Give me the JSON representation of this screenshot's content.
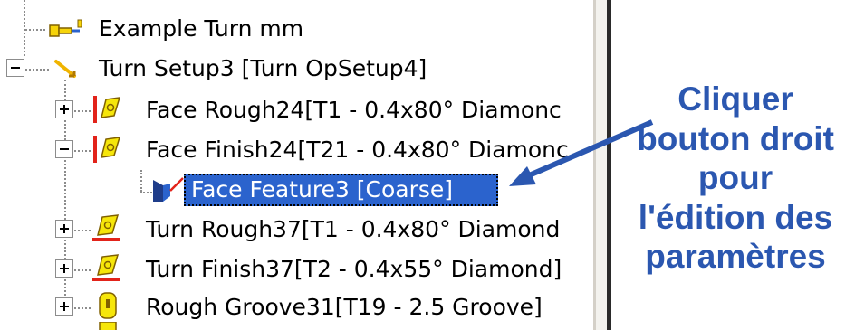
{
  "tree": {
    "root_label": "Example Turn mm",
    "setup_label": "Turn Setup3 [Turn OpSetup4]",
    "items": [
      {
        "label": "Face Rough24[T1 - 0.4x80° Diamonc"
      },
      {
        "label": "Face Finish24[T21 - 0.4x80° Diamonc"
      },
      {
        "label": "Face Feature3 [Coarse]"
      },
      {
        "label": "Turn Rough37[T1 - 0.4x80° Diamond"
      },
      {
        "label": "Turn Finish37[T2 - 0.4x55° Diamond]"
      },
      {
        "label": "Rough Groove31[T19 - 2.5 Groove]"
      }
    ]
  },
  "annotation": {
    "lines": [
      "Cliquer",
      "bouton droit",
      "pour",
      "l'édition des",
      "paramètres"
    ],
    "color": "#2b57b0"
  },
  "colors": {
    "selection": "#2b63cd",
    "operation_icon_fill": "#f6e60a",
    "operation_icon_mark": "#e2231a"
  }
}
